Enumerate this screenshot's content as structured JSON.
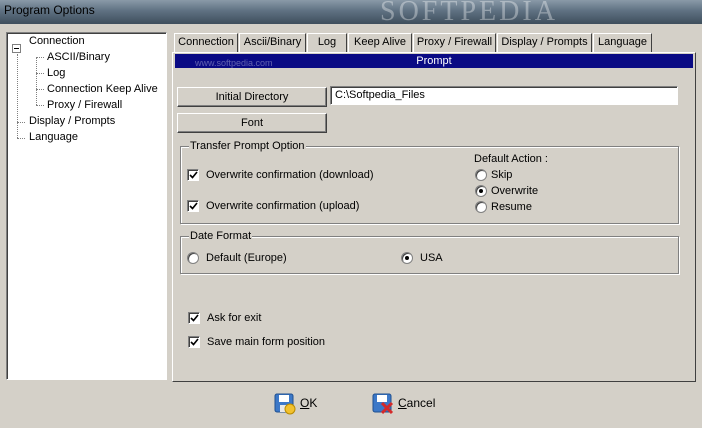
{
  "window": {
    "title": "Program Options",
    "watermark": "SOFTPEDIA"
  },
  "tree": {
    "expander_icon": "minus-box-icon",
    "items": [
      {
        "label": "Connection"
      },
      {
        "label": "ASCII/Binary"
      },
      {
        "label": "Log"
      },
      {
        "label": "Connection Keep Alive"
      },
      {
        "label": "Proxy / Firewall"
      },
      {
        "label": "Display / Prompts"
      },
      {
        "label": "Language"
      }
    ]
  },
  "tabs": [
    {
      "label": "Connection"
    },
    {
      "label": "Ascii/Binary"
    },
    {
      "label": "Log"
    },
    {
      "label": "Keep Alive"
    },
    {
      "label": "Proxy / Firewall"
    },
    {
      "label": "Display / Prompts",
      "active": true
    },
    {
      "label": "Language"
    }
  ],
  "panel": {
    "header": "Prompt",
    "watermark": "www.softpedia.com",
    "initial_directory_label": "Initial Directory",
    "initial_directory_value": "C:\\Softpedia_Files",
    "font_label": "Font",
    "transfer_group": {
      "title": "Transfer Prompt Option",
      "overwrite_download": {
        "label": "Overwrite confirmation (download)",
        "checked": true
      },
      "overwrite_upload": {
        "label": "Overwrite confirmation (upload)",
        "checked": true
      },
      "default_action_label": "Default Action :",
      "default_action_options": [
        {
          "label": "Skip",
          "selected": false
        },
        {
          "label": "Overwrite",
          "selected": true
        },
        {
          "label": "Resume",
          "selected": false
        }
      ]
    },
    "date_group": {
      "title": "Date Format",
      "options": [
        {
          "label": "Default (Europe)",
          "selected": false
        },
        {
          "label": "USA",
          "selected": true
        }
      ]
    },
    "ask_for_exit": {
      "label": "Ask for exit",
      "checked": true
    },
    "save_main_form_position": {
      "label": "Save main form position",
      "checked": true
    }
  },
  "footer": {
    "ok_label": "OK",
    "cancel_label": "Cancel",
    "ok_icon": "floppy-disk-icon",
    "cancel_icon": "cancel-x-icon"
  }
}
